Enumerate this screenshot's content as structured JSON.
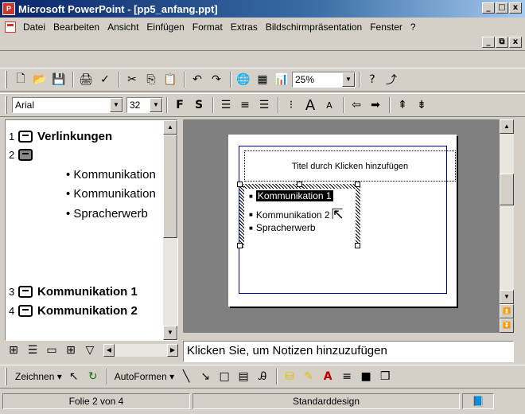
{
  "window": {
    "title": "Microsoft PowerPoint - [pp5_anfang.ppt]",
    "app_icon": "P",
    "min": "_",
    "max": "□",
    "close": "x"
  },
  "menu": {
    "items": [
      "Datei",
      "Bearbeiten",
      "Ansicht",
      "Einfügen",
      "Format",
      "Extras",
      "Bildschirmpräsentation",
      "Fenster",
      "?"
    ]
  },
  "standard_toolbar": {
    "zoom": "25%",
    "icons": [
      "new-icon",
      "open-icon",
      "save-icon",
      "print-icon",
      "spellcheck-icon",
      "cut-icon",
      "copy-icon",
      "paste-icon",
      "undo-icon",
      "redo-icon",
      "hyperlink-icon",
      "table-icon",
      "chart-icon",
      "help-icon",
      "pdf-icon"
    ]
  },
  "format_toolbar": {
    "font": "Arial",
    "size": "32",
    "bold": "F",
    "shadow": "S"
  },
  "outline": {
    "slides": [
      {
        "num": "1",
        "title": "Verlinkungen"
      },
      {
        "num": "2",
        "title": ""
      },
      {
        "num": "3",
        "title": "Kommunikation 1"
      },
      {
        "num": "4",
        "title": "Kommunikation 2"
      }
    ],
    "bullets": [
      "Kommunikation",
      "Kommunikation",
      "Spracherwerb"
    ]
  },
  "slide": {
    "title_placeholder": "Titel durch Klicken hinzufügen",
    "lines": [
      "Kommunikation 1",
      "Kommunikation 2",
      "Spracherwerb"
    ]
  },
  "notes": {
    "placeholder": "Klicken Sie, um Notizen hinzuzufügen"
  },
  "drawing_toolbar": {
    "draw": "Zeichnen",
    "autoshapes": "AutoFormen"
  },
  "status": {
    "slide": "Folie 2 von 4",
    "design": "Standarddesign"
  }
}
